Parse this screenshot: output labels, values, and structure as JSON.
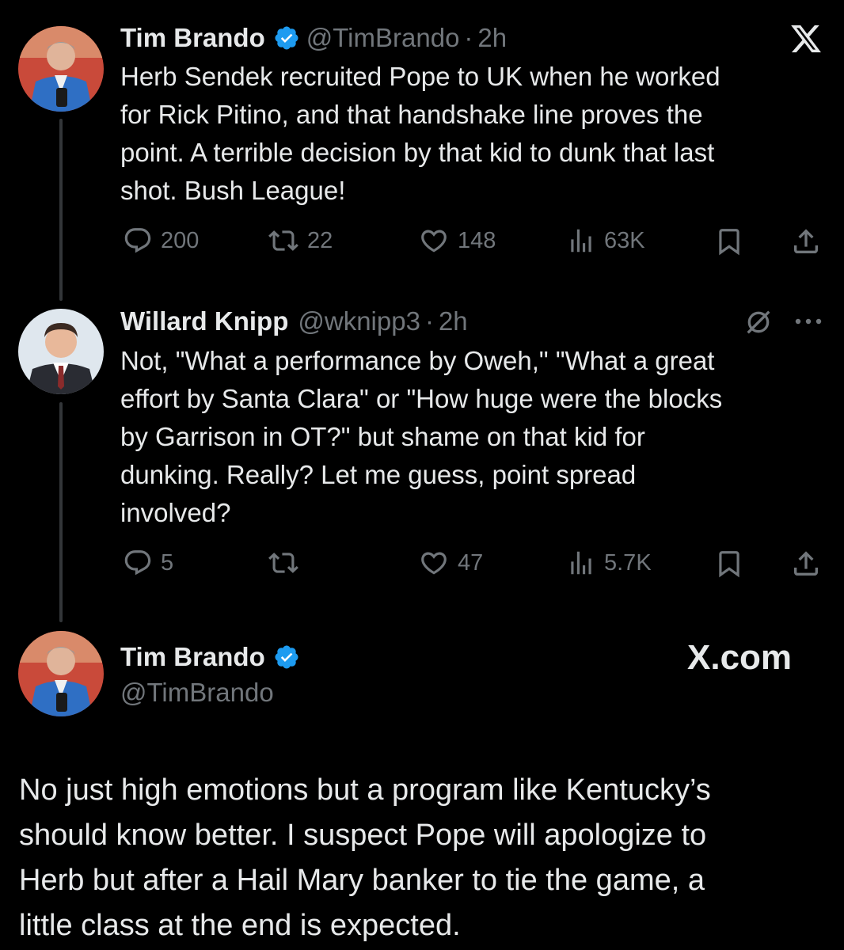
{
  "tweet1": {
    "name": "Tim Brando",
    "handle": "@TimBrando",
    "time": "2h",
    "body": "Herb Sendek recruited Pope to UK when he worked\nfor Rick Pitino, and that handshake line proves the\npoint. A terrible decision by that kid to dunk that last\nshot. Bush League!",
    "replies": "200",
    "reposts": "22",
    "likes": "148",
    "views": "63K"
  },
  "tweet2": {
    "name": "Willard Knipp",
    "handle": "@wknipp3",
    "time": "2h",
    "body": "Not, \"What a performance by Oweh,\" \"What a great\neffort by Santa Clara\" or \"How huge were the blocks\nby Garrison in OT?\" but shame on that kid for\ndunking. Really? Let me guess, point spread\ninvolved?",
    "replies": "5",
    "reposts": "",
    "likes": "47",
    "views": "5.7K"
  },
  "tweet3": {
    "name": "Tim Brando",
    "handle": "@TimBrando",
    "brand": "X.com",
    "body": "No just high emotions but a program like Kentucky’s\nshould know better. I suspect Pope will apologize to\nHerb but after a Hail Mary banker to tie the game, a\nlittle class at the end is expected."
  },
  "icons": {
    "verified": "verified-badge-icon",
    "x_logo": "x-logo-icon",
    "reply": "reply-icon",
    "repost": "repost-icon",
    "like": "like-icon",
    "views": "views-icon",
    "bookmark": "bookmark-icon",
    "share": "share-icon",
    "grok": "grok-icon",
    "more": "more-icon"
  },
  "colors": {
    "background": "#000000",
    "text": "#e7e9ea",
    "muted": "#71767b",
    "verified": "#1d9bf0"
  }
}
